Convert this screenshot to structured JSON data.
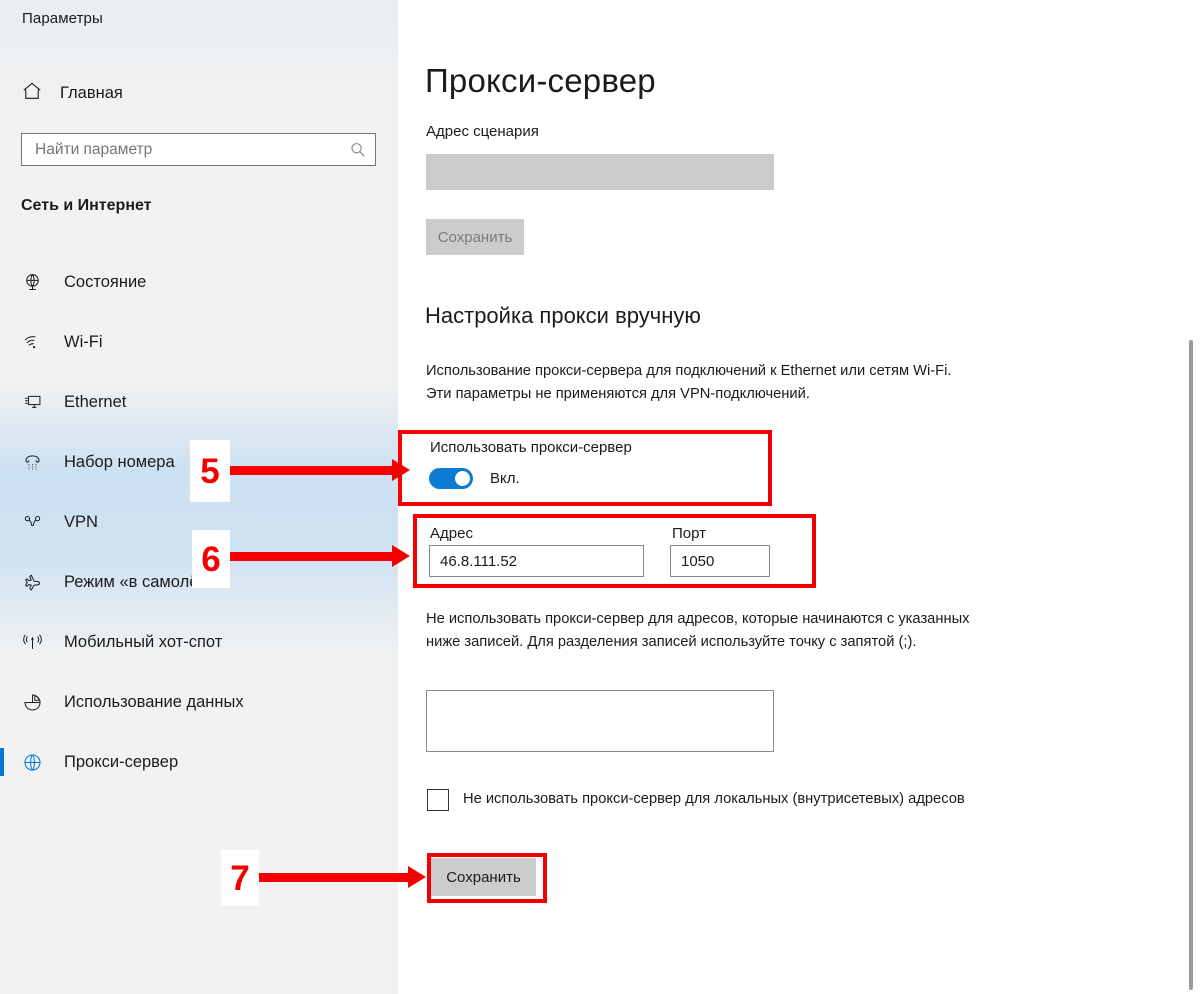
{
  "window": {
    "title": "Параметры",
    "controls": [
      {
        "name": "minimize",
        "glyph": "–"
      },
      {
        "name": "maximize",
        "glyph": "□"
      },
      {
        "name": "close",
        "glyph": "✕"
      }
    ]
  },
  "sidebar": {
    "home_label": "Главная",
    "home_icon": "home-icon",
    "search": {
      "placeholder": "Найти параметр",
      "value": "",
      "icon": "search-icon"
    },
    "category": "Сеть и Интернет",
    "items": [
      {
        "label": "Состояние",
        "icon": "globe-icon",
        "selected": false
      },
      {
        "label": "Wi-Fi",
        "icon": "wifi-icon",
        "selected": false
      },
      {
        "label": "Ethernet",
        "icon": "ethernet-icon",
        "selected": false
      },
      {
        "label": "Набор номера",
        "icon": "dialup-icon",
        "selected": false
      },
      {
        "label": "VPN",
        "icon": "vpn-icon",
        "selected": false
      },
      {
        "label": "Режим «в самолёте»",
        "icon": "airplane-icon",
        "selected": false
      },
      {
        "label": "Мобильный хот-спот",
        "icon": "hotspot-icon",
        "selected": false
      },
      {
        "label": "Использование данных",
        "icon": "pie-chart-icon",
        "selected": false
      },
      {
        "label": "Прокси-сервер",
        "icon": "globe-icon",
        "selected": true
      }
    ]
  },
  "main": {
    "page_title": "Прокси-сервер",
    "script_address": {
      "label": "Адрес сценария",
      "value": "",
      "disabled": true
    },
    "script_save_label": "Сохранить",
    "manual_section": {
      "heading": "Настройка прокси вручную",
      "description": "Использование прокси-сервера для подключений к Ethernet или сетям Wi-Fi. Эти параметры не применяются для VPN-подключений.",
      "use_proxy_label": "Использовать прокси-сервер",
      "toggle_state": "Вкл.",
      "toggle_on": true,
      "address_label": "Адрес",
      "address_value": "46.8.111.52",
      "port_label": "Порт",
      "port_value": "1050",
      "bypass_description": "Не использовать прокси-сервер для адресов, которые начинаются с указанных ниже записей. Для разделения записей используйте точку с запятой (;).",
      "bypass_value": "",
      "local_bypass_label": "Не использовать прокси-сервер для локальных (внутрисетевых) адресов",
      "local_bypass_checked": false,
      "save_label": "Сохранить"
    }
  },
  "annotations": [
    {
      "number": "5",
      "target": "use-proxy-toggle"
    },
    {
      "number": "6",
      "target": "address-port-fields"
    },
    {
      "number": "7",
      "target": "save-button"
    }
  ],
  "colors": {
    "accent": "#0078d7",
    "toggle_on": "#0b7bd4",
    "annotation": "#f40000",
    "sidebar_bg": "#f2f2f2",
    "disabled_bg": "#cccccc"
  }
}
